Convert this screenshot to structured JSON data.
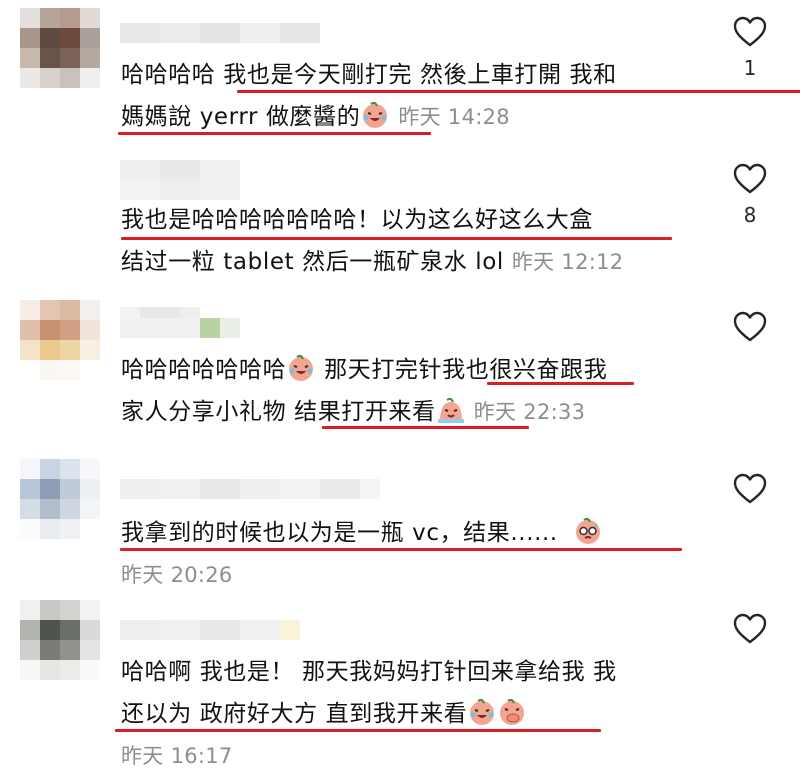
{
  "comments": [
    {
      "lines": [
        "哈哈哈哈 我也是今天剛打完 然後上車打開 我和",
        "媽媽說 yerrr 做麼醬的"
      ],
      "timestamp": "昨天 14:28",
      "likes": "1",
      "emojis": [
        "laughing-crying-emoji"
      ]
    },
    {
      "lines": [
        "我也是哈哈哈哈哈哈哈！以为这么好这么大盒",
        "结过一粒 tablet 然后一瓶矿泉水 lol"
      ],
      "timestamp": "昨天 12:12",
      "likes": "8",
      "emojis": []
    },
    {
      "lines": [
        "哈哈哈哈哈哈哈",
        " 那天打完针我也很兴奋跟我",
        "家人分享小礼物 结果打开来看"
      ],
      "timestamp": "昨天 22:33",
      "likes": "",
      "emojis": [
        "laughing-crying-emoji",
        "melting-crying-emoji"
      ]
    },
    {
      "lines": [
        "我拿到的时候也以为是一瓶 vc，结果......"
      ],
      "timestamp": "昨天 20:26",
      "likes": "",
      "emojis": [
        "sweating-face-emoji"
      ]
    },
    {
      "lines": [
        "哈哈啊 我也是！ 那天我妈妈打针回来拿给我 我",
        "还以为 政府好大方 直到我开来看"
      ],
      "timestamp": "昨天 16:17",
      "likes": "",
      "emojis": [
        "laughing-crying-emoji",
        "covering-mouth-emoji"
      ]
    }
  ],
  "colors": {
    "underline": "#d81f26",
    "timestamp": "#8e8e8e"
  },
  "icons": {
    "like": "heart-outline-icon"
  }
}
